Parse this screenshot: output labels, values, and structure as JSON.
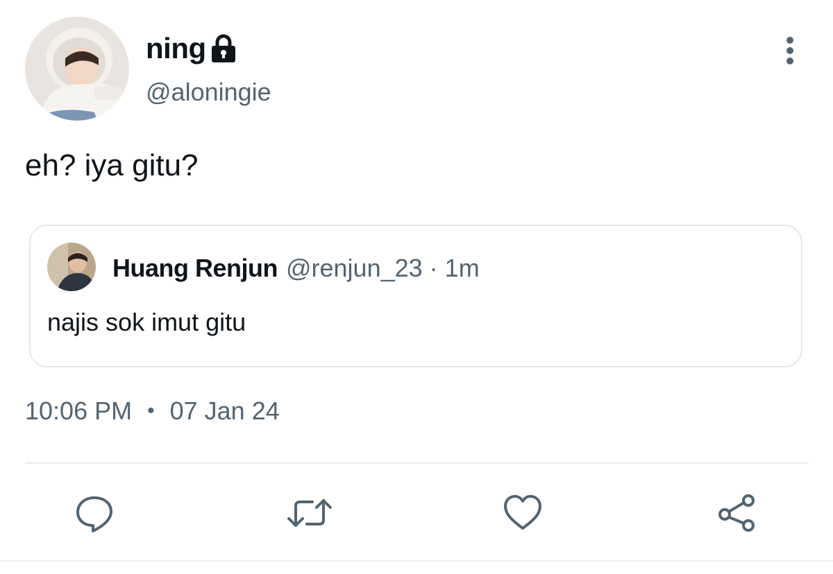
{
  "tweet": {
    "author": {
      "display_name": "ning",
      "handle": "@aloningie",
      "protected_icon": "lock-icon"
    },
    "text": "eh? iya gitu?",
    "quoted": {
      "display_name": "Huang Renjun",
      "handle": "@renjun_23",
      "separator": "·",
      "time": "1m",
      "text": "najis sok imut gitu"
    },
    "time": "10:06 PM",
    "separator": "•",
    "date": "07 Jan 24"
  },
  "actions": [
    {
      "icon": "reply-icon"
    },
    {
      "icon": "retweet-icon"
    },
    {
      "icon": "like-icon"
    },
    {
      "icon": "share-icon"
    }
  ],
  "colors": {
    "text_primary": "#0f1419",
    "text_secondary": "#536471",
    "border": "#e3e8ec"
  }
}
